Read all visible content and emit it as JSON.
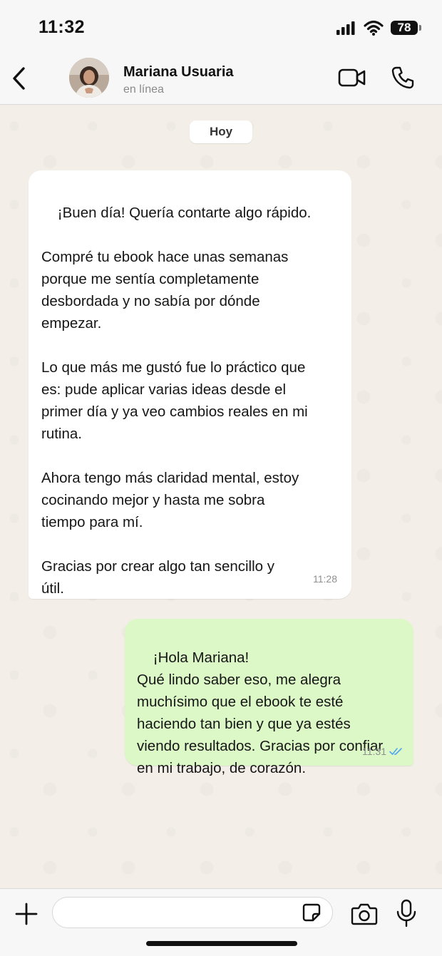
{
  "status_bar": {
    "time": "11:32",
    "battery": "78"
  },
  "header": {
    "contact_name": "Mariana Usuaria",
    "contact_status": "en línea"
  },
  "chat": {
    "date_chip": "Hoy",
    "messages": [
      {
        "direction": "incoming",
        "text": "¡Buen día! Quería contarte algo rápido.\n\nCompré tu ebook hace unas semanas\nporque me sentía completamente\ndesbordada y no sabía por dónde\nempezar.\n\nLo que más me gustó fue lo práctico que\nes: pude aplicar varias ideas desde el\nprimer día y ya veo cambios reales en mi\nrutina.\n\nAhora tengo más claridad mental, estoy\ncocinando mejor y hasta me sobra\ntiempo para mí.\n\nGracias por crear algo tan sencillo y\nútil.",
        "time": "11:28"
      },
      {
        "direction": "outgoing",
        "text": "¡Hola Mariana!\nQué lindo saber eso, me alegra\nmuchísimo que el ebook te esté\nhaciendo tan bien y que ya estés\nviendo resultados. Gracias por confiar\nen mi trabajo, de corazón.",
        "time": "11:31",
        "read_receipt_icon": "double-check-icon",
        "read_receipt_color": "#53a6f0"
      }
    ]
  },
  "input_bar": {
    "message_value": "",
    "icons": [
      "plus-icon",
      "sticker-icon",
      "camera-icon",
      "microphone-icon"
    ]
  },
  "colors": {
    "incoming_bubble": "#ffffff",
    "outgoing_bubble": "#dbf8c6",
    "chat_background": "#f3efe8"
  }
}
